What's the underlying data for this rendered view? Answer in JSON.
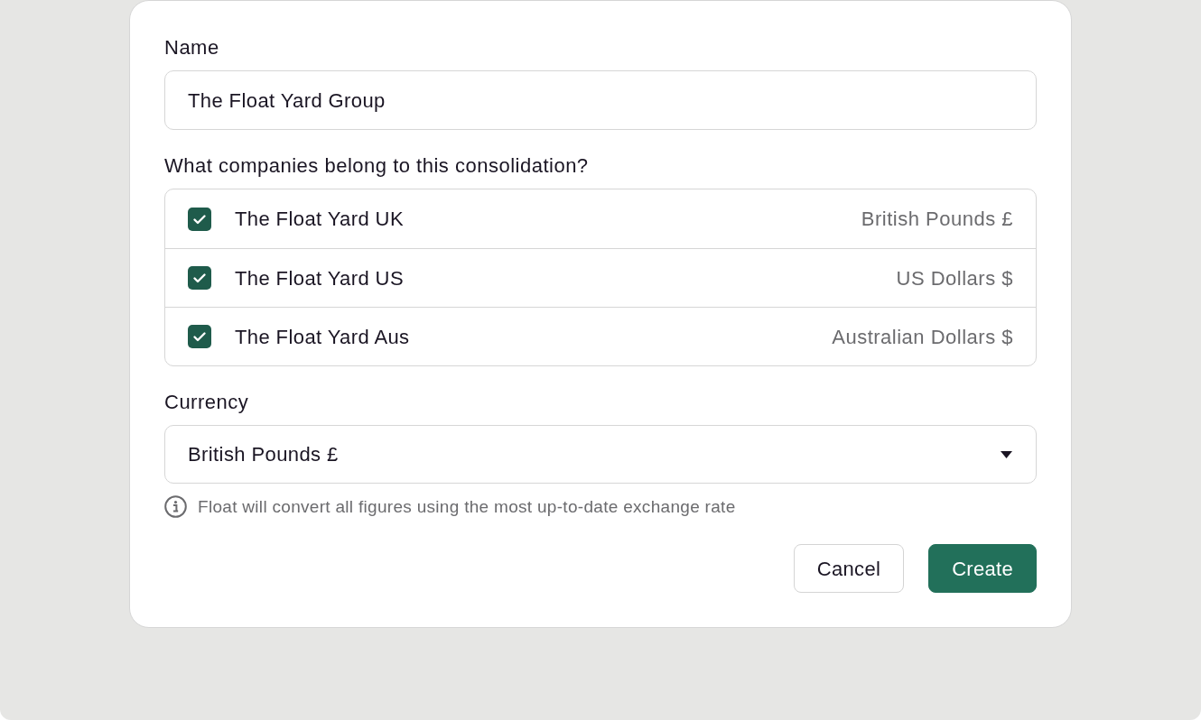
{
  "name_field": {
    "label": "Name",
    "value": "The Float Yard Group"
  },
  "companies": {
    "label": "What companies belong to this consolidation?",
    "items": [
      {
        "name": "The Float Yard UK",
        "currency": "British Pounds £",
        "checked": true
      },
      {
        "name": "The Float Yard US",
        "currency": "US Dollars $",
        "checked": true
      },
      {
        "name": "The Float Yard Aus",
        "currency": "Australian Dollars $",
        "checked": true
      }
    ]
  },
  "currency_field": {
    "label": "Currency",
    "value": "British Pounds £"
  },
  "info": "Float will convert all figures using the most up-to-date exchange rate",
  "buttons": [
    {
      "label": "Cancel",
      "kind": "secondary"
    },
    {
      "label": "Create",
      "kind": "primary"
    }
  ]
}
